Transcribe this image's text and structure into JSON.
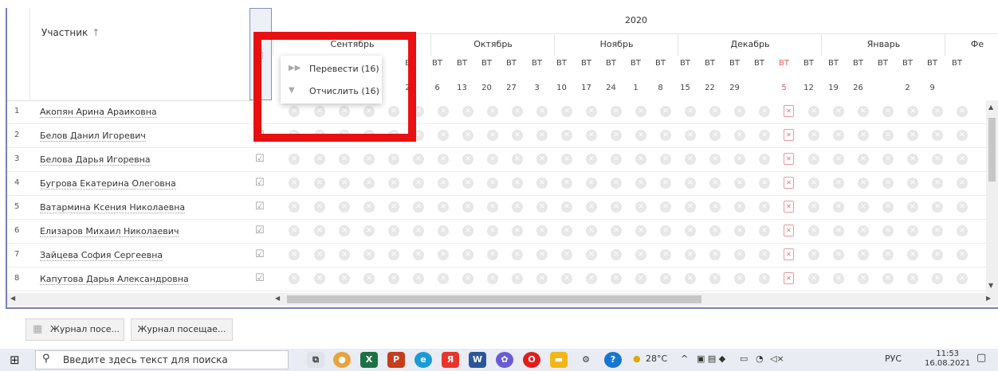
{
  "table": {
    "participant_header": "Участник",
    "sort_indicator": "↑",
    "year": "2020",
    "months": [
      {
        "label": "Сентябрь"
      },
      {
        "label": "Октябрь"
      },
      {
        "label": "Ноябрь"
      },
      {
        "label": "Декабрь"
      },
      {
        "label": "Январь"
      },
      {
        "label": "Фе"
      }
    ],
    "weekday_label": "ВТ",
    "weekday_partial": "В",
    "dates": [
      "2",
      "6",
      "13",
      "20",
      "27",
      "3",
      "10",
      "17",
      "24",
      "1",
      "8",
      "15",
      "22",
      "29",
      "5",
      "12",
      "19",
      "26",
      "2",
      "9"
    ],
    "rows": [
      {
        "num": "1",
        "name": "Акопян Арина Араиковна"
      },
      {
        "num": "2",
        "name": "Белов Данил Игоревич"
      },
      {
        "num": "3",
        "name": "Белова Дарья Игоревна"
      },
      {
        "num": "4",
        "name": "Бугрова Екатерина Олеговна"
      },
      {
        "num": "5",
        "name": "Ватармина Ксения Николаевна"
      },
      {
        "num": "6",
        "name": "Елизаров Михаил Николаевич"
      },
      {
        "num": "7",
        "name": "Зайцева София Сергеевна"
      },
      {
        "num": "8",
        "name": "Капутова Дарья Александровна"
      }
    ],
    "highlight_color": "#e06060"
  },
  "context_menu": {
    "items": [
      {
        "label": "Перевести (16)",
        "icon": "fast-forward-icon"
      },
      {
        "label": "Отчислить (16)",
        "icon": "thumbs-down-icon"
      }
    ]
  },
  "footer_tabs": [
    {
      "label": "Журнал посе..."
    },
    {
      "label": "Журнал посещае..."
    }
  ],
  "taskbar": {
    "search_placeholder": "Введите здесь текст для поиска",
    "weather": "28°C",
    "language": "РУС",
    "time": "11:53",
    "date": "16.08.2021"
  },
  "annotation_color": "#e81010"
}
